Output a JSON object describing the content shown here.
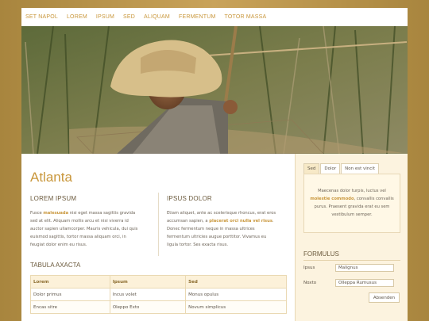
{
  "nav": {
    "items": [
      "Set Napol",
      "Lorem",
      "Ipsum",
      "Sed",
      "Aliquam",
      "Fermentum",
      "Totor Massa"
    ]
  },
  "site": {
    "title": "Atlanta"
  },
  "col1": {
    "heading": "Lorem Ipsum",
    "t1": "Fusce ",
    "hl": "malesuada",
    "t2": " nisi eget massa sagittis gravida sed at elit. Aliquam mollis arcu et nisi viverra id auctor sapien ullamcorper. Mauris vehicula, dui quis euismod sagittis, tortor massa aliquam orci, in feugiat dolor enim eu risus."
  },
  "col2": {
    "heading": "Ipsus Dolor",
    "t1": "Etiam aliquet, ante ac scelerisque rhoncus, erat eros accumsan sapien, a ",
    "hl": "placerat orci nulla vel risus",
    "t2": ". Donec fermentum neque in massa ultrices fermentum ultricies augue porttitor. Vivamus eu ligula tortor. Ses exacta risus."
  },
  "table": {
    "title": "Tabula Axacta",
    "headers": [
      "Lorem",
      "Ipsum",
      "Sed"
    ],
    "rows": [
      [
        "Dolor primus",
        "Incus volet",
        "Monus opulus"
      ],
      [
        "Encas sitre",
        "Oleppo Exto",
        "Novum simplicus"
      ]
    ]
  },
  "sidebar": {
    "tabs": [
      "Sed",
      "Dolor",
      "Non est vincit"
    ],
    "panel": {
      "t1": "Maecenas dolor turpis, luctus vel ",
      "hl": "molestie commodo",
      "t2": ", convallis convallis purus. Praesent gravida erat eu sem vestibulum semper."
    },
    "form": {
      "heading": "Formulus",
      "field1_label": "Ipsus",
      "field1_value": "Malignus",
      "field2_label": "Noxto",
      "field2_value": "Olleppa Rumusus",
      "submit_label": "Absenden"
    }
  },
  "colors": {
    "accent": "#c9973c",
    "background": "#b8934a",
    "sidebar": "#fcf3df"
  },
  "icons": {
    "hero": "hero-photo-boy-with-fishing-net"
  }
}
